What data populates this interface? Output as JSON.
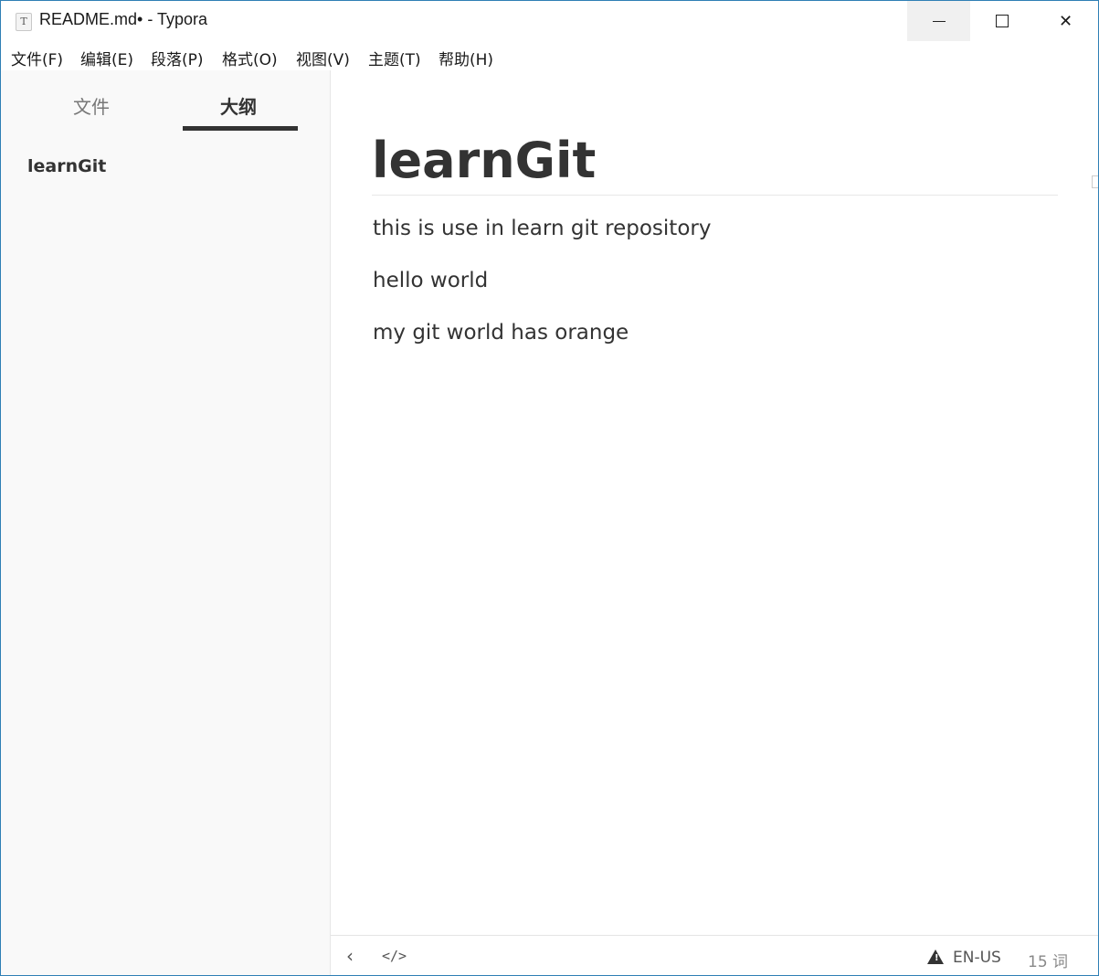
{
  "window": {
    "title": "README.md• - Typora",
    "icon": "T",
    "controls": {
      "minimize": "minimize-icon",
      "maximize": "maximize-icon",
      "close": "✕"
    }
  },
  "menu": {
    "items": [
      {
        "label": "文件(F)"
      },
      {
        "label": "编辑(E)"
      },
      {
        "label": "段落(P)"
      },
      {
        "label": "格式(O)"
      },
      {
        "label": "视图(V)"
      },
      {
        "label": "主题(T)"
      },
      {
        "label": "帮助(H)"
      }
    ]
  },
  "sidebar": {
    "tabs": [
      {
        "label": "文件",
        "active": false
      },
      {
        "label": "大纲",
        "active": true
      }
    ],
    "outline": [
      {
        "label": "learnGit"
      }
    ]
  },
  "document": {
    "heading": "learnGit",
    "paragraphs": [
      "this is use in learn git repository",
      "hello world",
      "my git world has orange"
    ]
  },
  "statusbar": {
    "back_icon": "chevron-left-icon",
    "code_icon": "source-code-icon",
    "warning_icon": "warning-icon",
    "language": "EN-US",
    "word_count": "15 词"
  },
  "colors": {
    "text": "#333333",
    "sidebar_bg": "#f9f9f9",
    "window_border": "#2f7fb5"
  }
}
